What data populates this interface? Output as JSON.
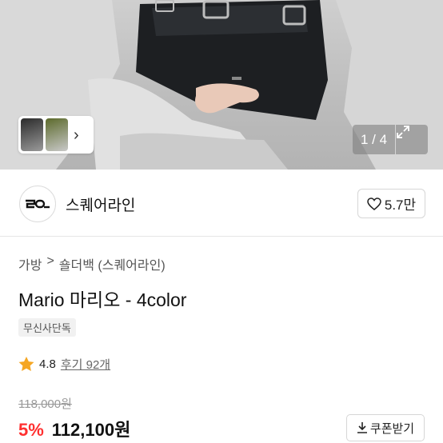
{
  "gallery": {
    "counter": "1 / 4",
    "thumbs_chevron": "›",
    "expand_icon": "expand-icon"
  },
  "brand": {
    "logo_text": "SQ",
    "name": "스퀘어라인",
    "like_count": "5.7만"
  },
  "product": {
    "breadcrumb": [
      "가방",
      "숄더백 (스퀘어라인)"
    ],
    "breadcrumb_sep": ">",
    "title": "Mario 마리오 - 4color",
    "badge": "무신사단독",
    "rating": "4.8",
    "reviews": "후기 92개",
    "original_price": "118,000원",
    "discount": "5%",
    "price": "112,100원",
    "coupon_label": "쿠폰받기"
  },
  "colors": {
    "discount": "#ff2f2f",
    "star": "#f5a623"
  }
}
